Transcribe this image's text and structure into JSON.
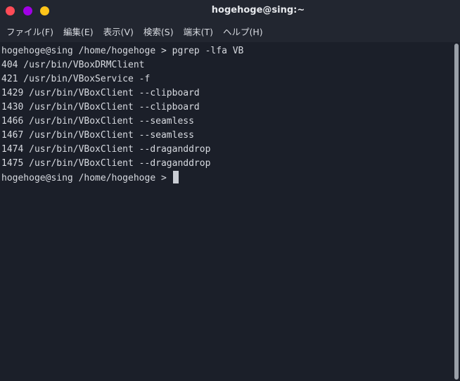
{
  "window": {
    "title": "hogehoge@sing:~",
    "buttons": {
      "close_color": "#ff4b57",
      "minimize_color": "#a100e6",
      "maximize_color": "#ffc41a"
    }
  },
  "menu": {
    "items": [
      {
        "label": "ファイル(F)"
      },
      {
        "label": "編集(E)"
      },
      {
        "label": "表示(V)"
      },
      {
        "label": "検索(S)"
      },
      {
        "label": "端末(T)"
      },
      {
        "label": "ヘルプ(H)"
      }
    ]
  },
  "terminal": {
    "lines": [
      "hogehoge@sing /home/hogehoge > pgrep -lfa VB",
      "404 /usr/bin/VBoxDRMClient",
      "421 /usr/bin/VBoxService -f",
      "1429 /usr/bin/VBoxClient --clipboard",
      "1430 /usr/bin/VBoxClient --clipboard",
      "1466 /usr/bin/VBoxClient --seamless",
      "1467 /usr/bin/VBoxClient --seamless",
      "1474 /usr/bin/VBoxClient --draganddrop",
      "1475 /usr/bin/VBoxClient --draganddrop"
    ],
    "prompt": "hogehoge@sing /home/hogehoge > "
  }
}
